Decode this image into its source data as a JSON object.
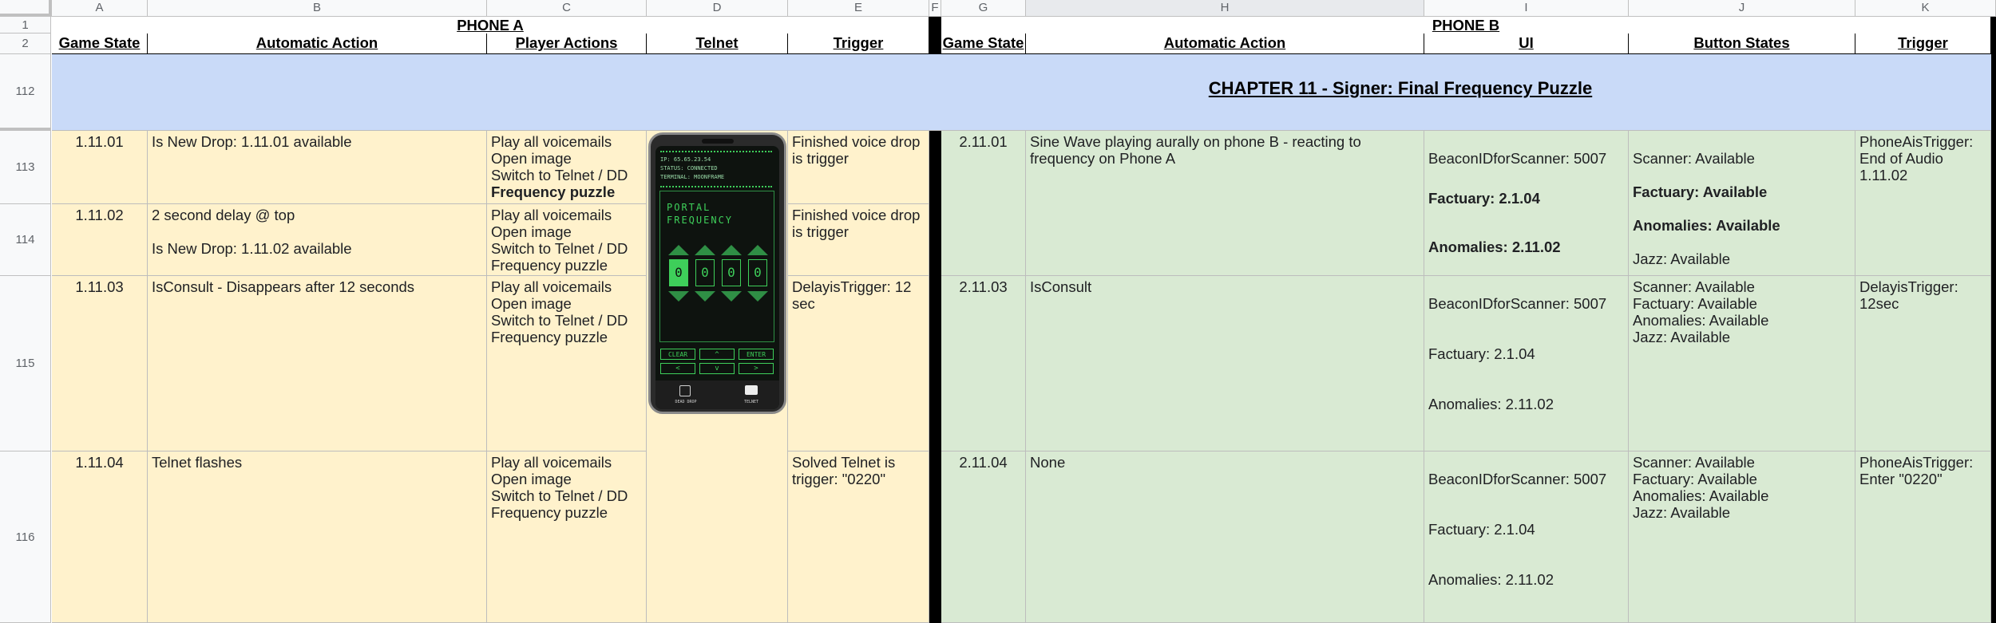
{
  "columns": [
    "A",
    "B",
    "C",
    "D",
    "E",
    "F",
    "G",
    "H",
    "I",
    "J",
    "K"
  ],
  "rows": {
    "r1": "1",
    "r2": "2",
    "r112": "112",
    "r113": "113",
    "r114": "114",
    "r115": "115",
    "r116": "116"
  },
  "headers": {
    "phone_a": "PHONE A",
    "phone_b": "PHONE B",
    "a_game_state": "Game State",
    "a_auto_action": "Automatic Action",
    "a_player_actions": "Player Actions",
    "a_telnet": "Telnet",
    "a_trigger": "Trigger",
    "b_game_state": "Game State",
    "b_auto_action": "Automatic Action",
    "b_ui": "UI",
    "b_button_states": "Button States",
    "b_trigger": "Trigger"
  },
  "chapter": "CHAPTER 11 - Signer: Final Frequency Puzzle",
  "phone_a_rows": [
    {
      "state": "1.11.01",
      "action": "Is New Drop: 1.11.01 available",
      "player": "Play all voicemails\nOpen image\nSwitch to Telnet / DD",
      "player_bold": "Frequency puzzle",
      "trigger": "Finished voice drop is trigger"
    },
    {
      "state": "1.11.02",
      "action": "2 second delay @ top\n\nIs New Drop: 1.11.02 available",
      "player": "Play all voicemails\nOpen image\nSwitch to Telnet / DD\nFrequency puzzle",
      "trigger": "Finished voice drop is trigger"
    },
    {
      "state": "1.11.03",
      "action": "IsConsult - Disappears after 12 seconds",
      "player": "Play all voicemails\nOpen image\nSwitch to Telnet / DD\nFrequency puzzle",
      "trigger": "DelayisTrigger: 12 sec"
    },
    {
      "state": "1.11.04",
      "action": "Telnet flashes",
      "player": "Play all voicemails\nOpen image\nSwitch to Telnet / DD\nFrequency puzzle",
      "trigger": "Solved Telnet is trigger: \"0220\""
    }
  ],
  "phone_b_rows": [
    {
      "state": "2.11.01",
      "action": "Sine Wave playing aurally on phone B - reacting to frequency on Phone A",
      "ui_1": "BeaconIDforScanner: 5007",
      "ui_2": "Factuary: 2.1.04",
      "ui_3": "Anomalies: 2.11.02",
      "btn_1": "Scanner: Available",
      "btn_2": "Factuary: Available",
      "btn_3": "Anomalies: Available",
      "btn_4": "Jazz: Available",
      "trigger": "PhoneAisTrigger: End of Audio 1.11.02"
    },
    {
      "state": "2.11.03",
      "action": "IsConsult",
      "ui_1": "BeaconIDforScanner: 5007",
      "ui_2": "Factuary: 2.1.04",
      "ui_3": "Anomalies: 2.11.02",
      "buttons": "Scanner: Available\nFactuary: Available\nAnomalies: Available\nJazz: Available",
      "trigger": "DelayisTrigger: 12sec"
    },
    {
      "state": "2.11.04",
      "action": "None",
      "ui_1": "BeaconIDforScanner: 5007",
      "ui_2": "Factuary: 2.1.04",
      "ui_3": "Anomalies: 2.11.02",
      "buttons": "Scanner: Available\nFactuary: Available\nAnomalies: Available\nJazz: Available",
      "trigger": "PhoneAisTrigger: Enter \"0220\""
    }
  ],
  "telnet_screen": {
    "ip": "IP: 65.65.23.54",
    "status": "STATUS: CONNECTED",
    "terminal": "TERMINAL: MOONFRAME",
    "title_1": "PORTAL",
    "title_2": "FREQUENCY",
    "digits": [
      "0",
      "0",
      "0",
      "0"
    ],
    "clear": "CLEAR",
    "up": "^",
    "enter": "ENTER",
    "left": "<",
    "down": "v",
    "right": ">",
    "nav_left": "DEAD DROP",
    "nav_right": "TELNET"
  },
  "colors": {
    "phone_a_fill": "#fff2cc",
    "phone_b_fill": "#d9ead3",
    "chapter_fill": "#c9daf8",
    "divider": "#000000",
    "telnet_green": "#3ecf5a"
  }
}
